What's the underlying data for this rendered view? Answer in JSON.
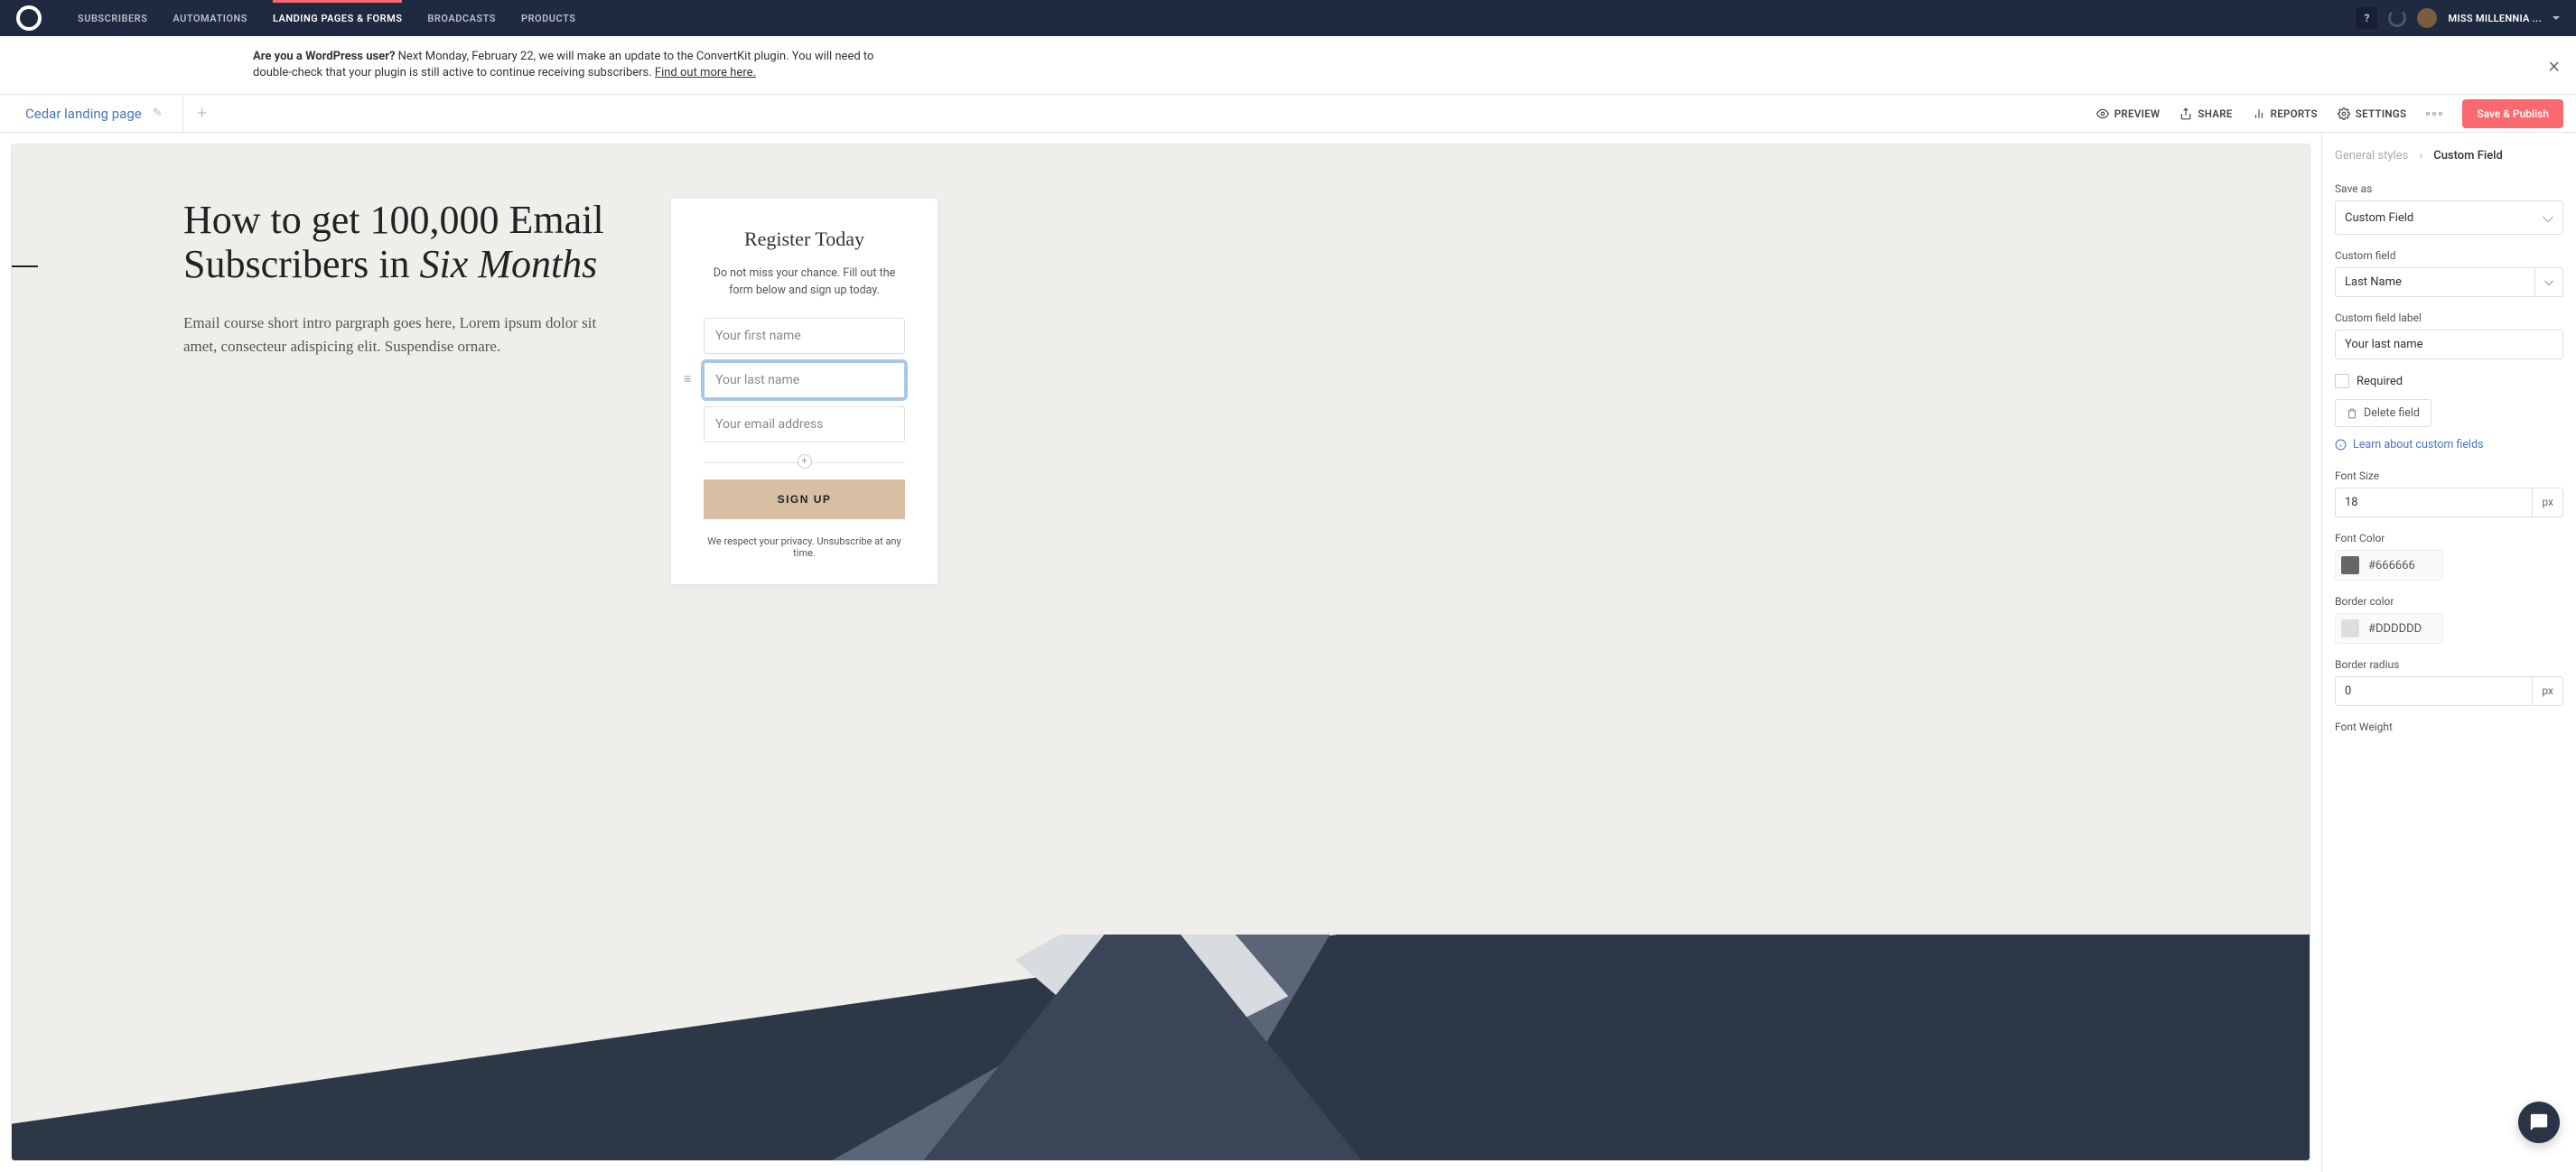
{
  "topnav": {
    "items": [
      "SUBSCRIBERS",
      "AUTOMATIONS",
      "LANDING PAGES & FORMS",
      "BROADCASTS",
      "PRODUCTS"
    ],
    "help": "?",
    "user": "MISS MILLENNIA ..."
  },
  "banner": {
    "bold": "Are you a WordPress user?",
    "text": " Next Monday, February 22, we will make an update to the ConvertKit plugin. You will need to double-check that your plugin is still active to continue receiving subscribers. ",
    "link": "Find out more here."
  },
  "toolbar": {
    "title": "Cedar landing page",
    "preview": "PREVIEW",
    "share": "SHARE",
    "reports": "REPORTS",
    "settings": "SETTINGS",
    "save": "Save & Publish"
  },
  "landing": {
    "headline_p1": "How to get 100,000 Email Subscribers in ",
    "headline_em": "Six Months",
    "intro": "Email course short intro pargraph goes here, Lorem ipsum dolor sit amet, consecteur adispicing elit. Suspendise ornare.",
    "form_title": "Register Today",
    "form_sub": "Do not miss your chance. Fill out the form below and sign up today.",
    "ph_first": "Your first name",
    "ph_last": "Your last name",
    "ph_email": "Your email address",
    "signup": "SIGN UP",
    "privacy": "We respect your privacy. Unsubscribe at any time."
  },
  "panel": {
    "bc_prev": "General styles",
    "bc_cur": "Custom Field",
    "save_as_label": "Save as",
    "save_as_value": "Custom Field",
    "custom_field_label": "Custom field",
    "custom_field_value": "Last Name",
    "cfl_label": "Custom field label",
    "cfl_value": "Your last name",
    "required": "Required",
    "delete": "Delete field",
    "learn": "Learn about custom fields",
    "font_size_label": "Font Size",
    "font_size_value": "18",
    "px": "px",
    "font_color_label": "Font Color",
    "font_color_value": "#666666",
    "border_color_label": "Border color",
    "border_color_value": "#DDDDDD",
    "border_radius_label": "Border radius",
    "border_radius_value": "0",
    "font_weight_label": "Font Weight"
  }
}
